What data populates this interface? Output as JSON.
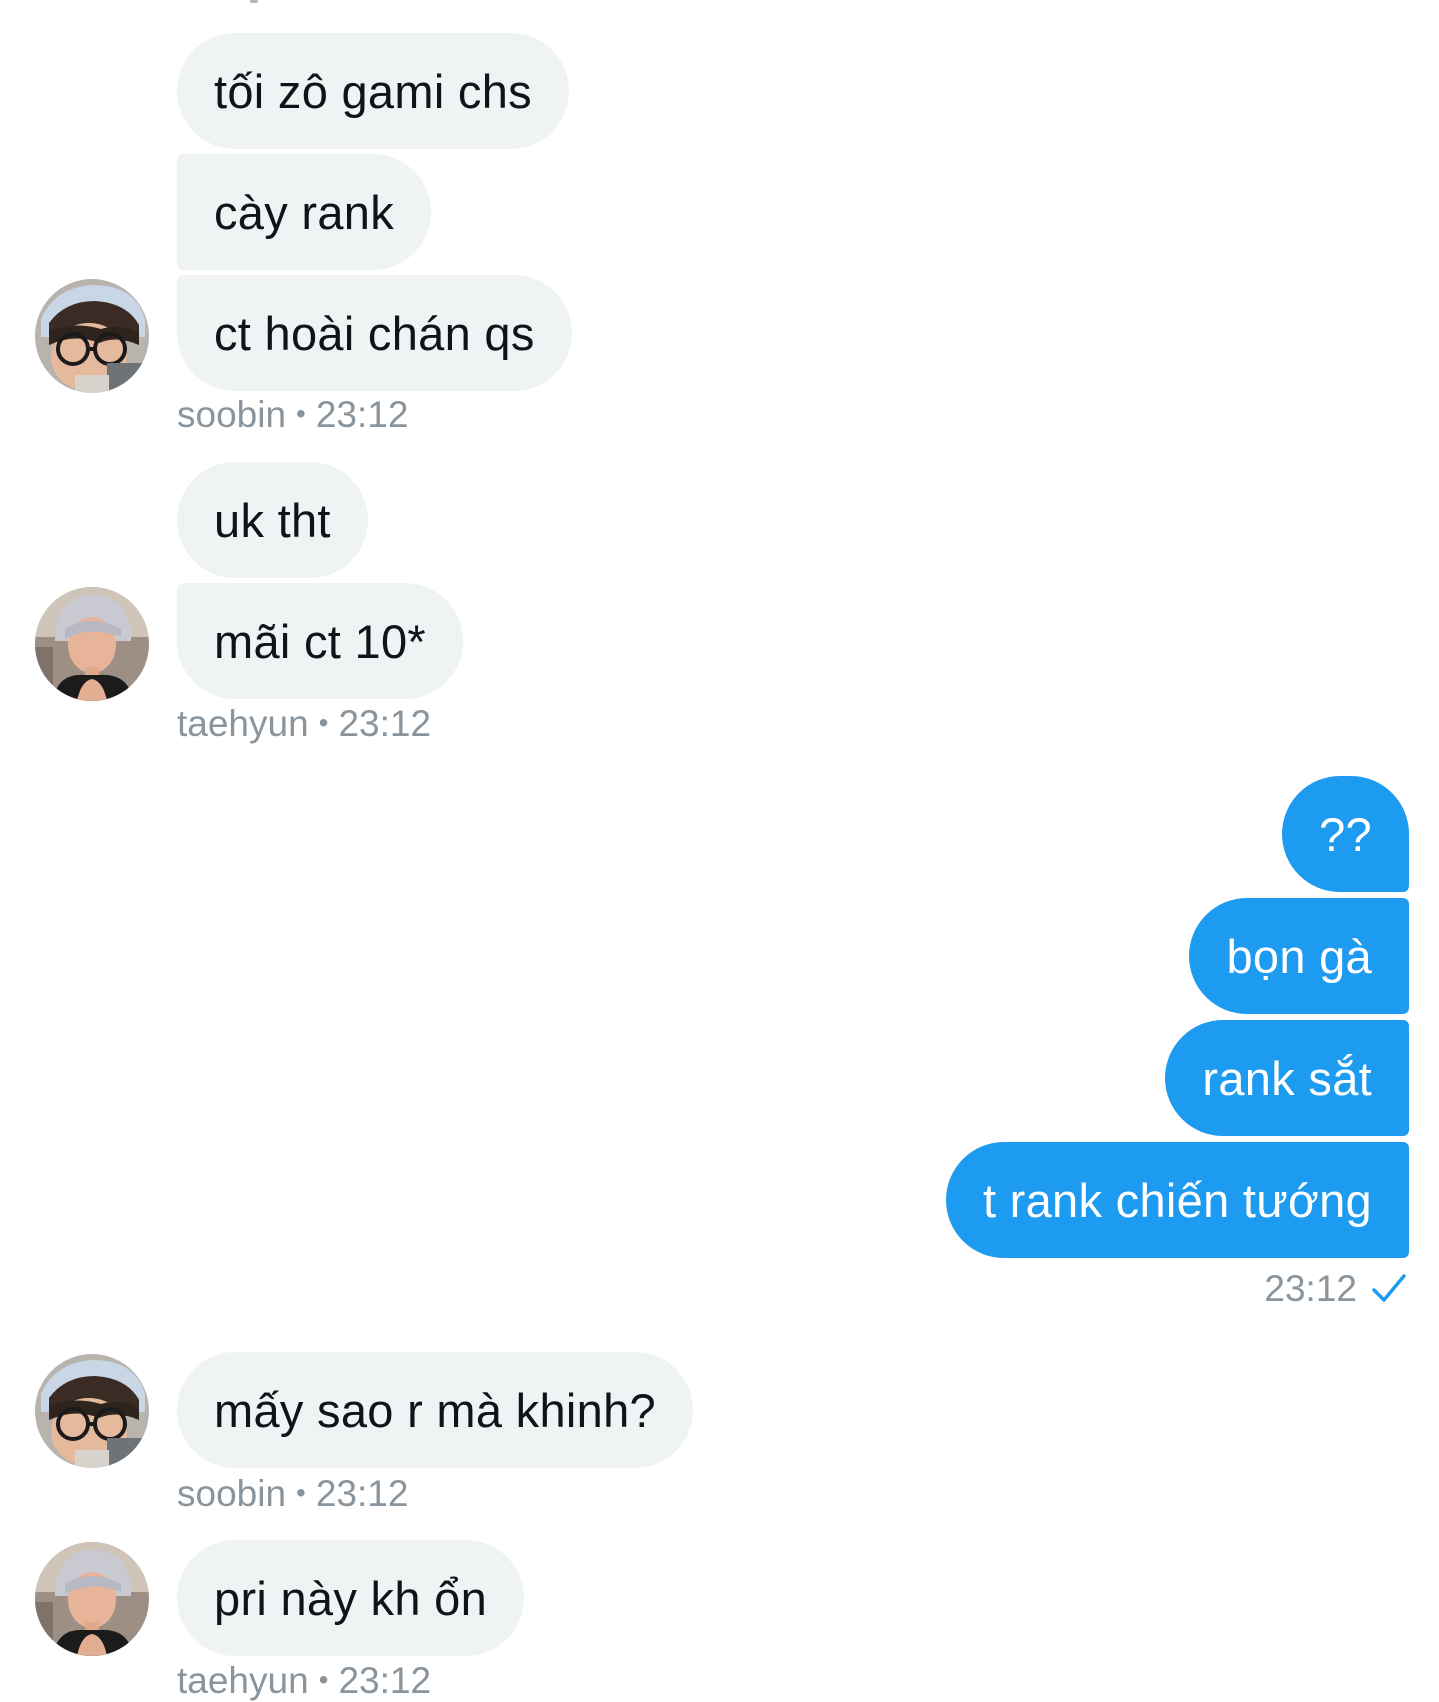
{
  "colors": {
    "accent": "#1d9bf0",
    "incoming_bubble": "#eff3f4",
    "meta_text": "#8a949c"
  },
  "groups": [
    {
      "sender": "soobin",
      "time": "23:12",
      "messages": [
        "tối zô gami chs",
        "cày rank",
        "ct hoài chán qs"
      ]
    },
    {
      "sender": "taehyun",
      "time": "23:12",
      "messages": [
        "uk tht",
        "mãi ct 10*"
      ]
    },
    {
      "sender": "me",
      "time": "23:12",
      "status_icon": "check-icon",
      "messages": [
        "??",
        "bọn gà",
        "rank sắt",
        "t rank chiến tướng"
      ]
    },
    {
      "sender": "soobin",
      "time": "23:12",
      "messages": [
        "mấy sao r mà khinh?"
      ]
    },
    {
      "sender": "taehyun",
      "time": "23:12",
      "messages": [
        "pri này kh ổn"
      ]
    }
  ],
  "meta_separator": "•"
}
